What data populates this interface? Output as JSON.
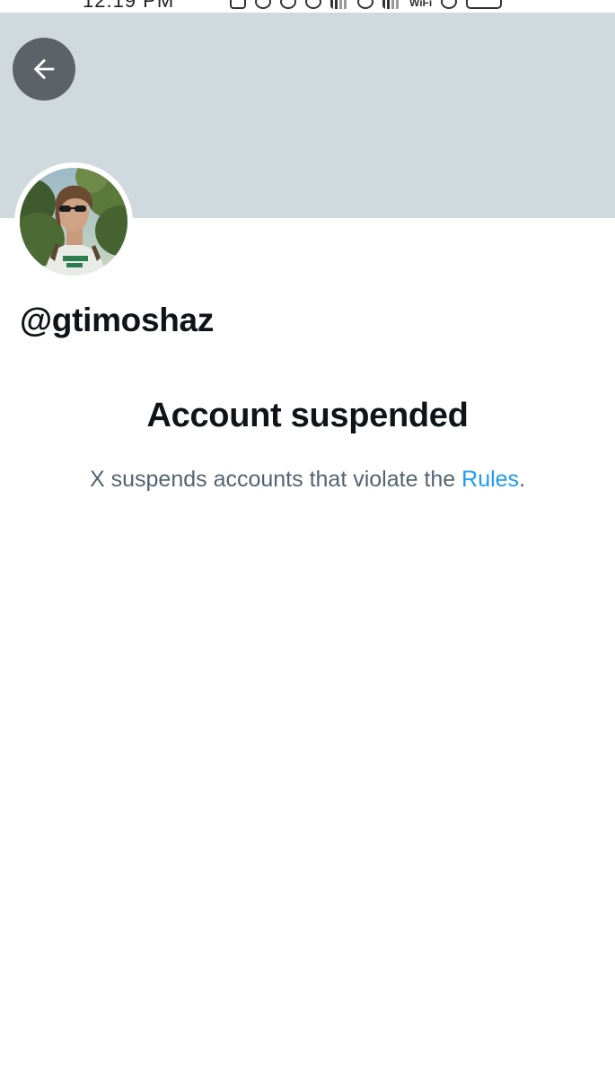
{
  "status_bar": {
    "time": "12:19 PM",
    "wifi_label": "WiFi"
  },
  "profile": {
    "handle": "@gtimoshaz"
  },
  "suspension": {
    "title": "Account suspended",
    "message_prefix": "X suspends accounts that violate the ",
    "rules_link": "Rules",
    "message_suffix": "."
  },
  "colors": {
    "banner": "#cfd9de",
    "link": "#1d9bf0",
    "secondary_text": "#536471",
    "primary_text": "#0f1419"
  },
  "icons": {
    "back": "arrow-left-icon"
  }
}
